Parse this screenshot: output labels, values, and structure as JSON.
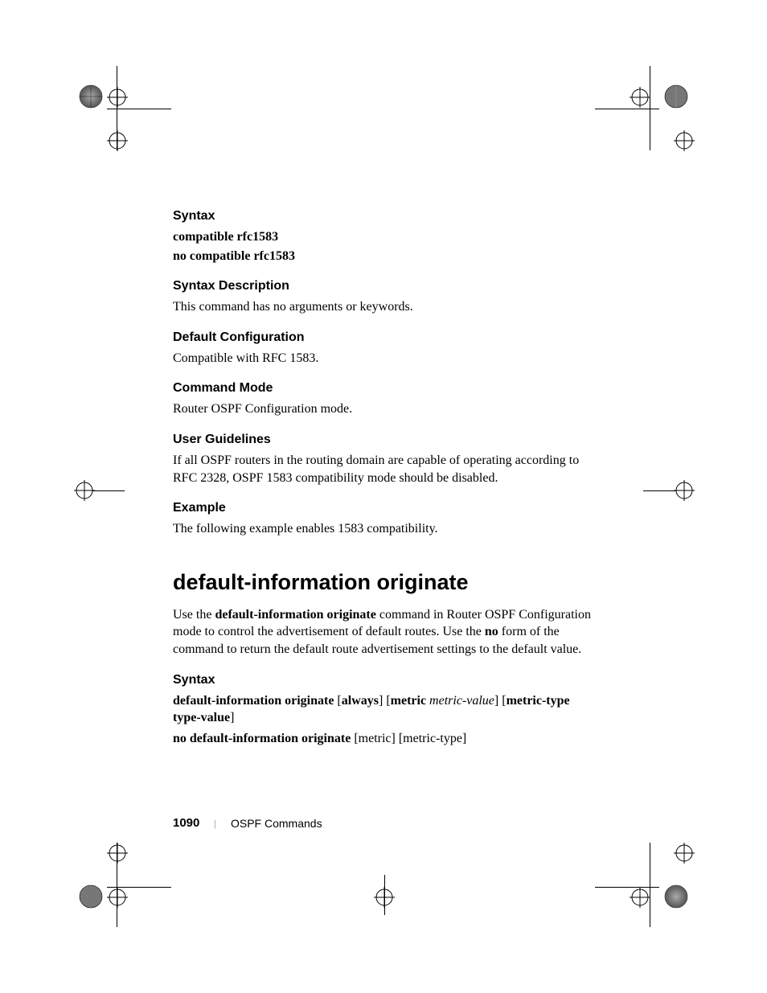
{
  "sections": {
    "syntax1": {
      "heading": "Syntax",
      "line1": "compatible rfc1583",
      "line2": "no compatible rfc1583"
    },
    "syntaxDesc": {
      "heading": "Syntax Description",
      "text": "This command has no arguments or keywords."
    },
    "defaultConfig": {
      "heading": "Default Configuration",
      "text": "Compatible with RFC 1583."
    },
    "commandMode": {
      "heading": "Command Mode",
      "text": "Router OSPF Configuration mode."
    },
    "userGuidelines": {
      "heading": "User Guidelines",
      "text": "If all OSPF routers in the routing domain are capable of operating according to RFC 2328, OSPF 1583 compatibility mode should be disabled."
    },
    "example": {
      "heading": "Example",
      "text": "The following example enables 1583 compatibility."
    }
  },
  "command2": {
    "title": "default-information originate",
    "intro": {
      "prefix": "Use the ",
      "bold1": "default-information originate",
      "mid1": " command in Router OSPF Configuration mode to control the advertisement of default routes. Use the ",
      "bold2": "no",
      "suffix": " form of the command to return the default route advertisement settings to the default value."
    },
    "syntax": {
      "heading": "Syntax",
      "line1": {
        "p1": "default-information originate",
        "p2": " [",
        "p3": "always",
        "p4": "] [",
        "p5": "metric",
        "p6": " ",
        "p7": "metric-value",
        "p8": "] [",
        "p9": "metric-type type-value",
        "p10": "]"
      },
      "line2": {
        "p1": "no default-information originate",
        "p2": " [metric] [metric-type]"
      }
    }
  },
  "footer": {
    "pageNum": "1090",
    "sep": "|",
    "label": "OSPF Commands"
  }
}
